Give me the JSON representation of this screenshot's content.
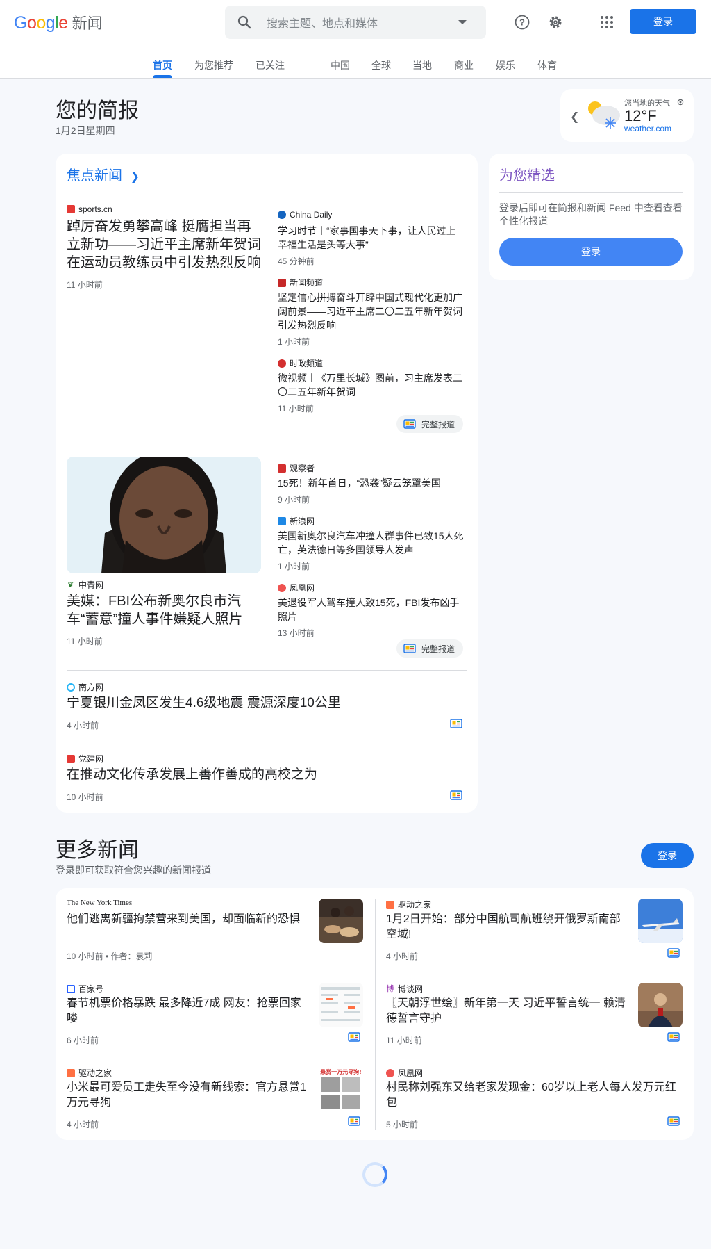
{
  "header": {
    "logo_google": "Google",
    "logo_product": "新闻",
    "search_placeholder": "搜索主题、地点和媒体",
    "signin_label": "登录",
    "icons": [
      "help-icon",
      "settings-icon",
      "apps-icon",
      "search-icon"
    ]
  },
  "tabs": [
    {
      "label": "首页",
      "active": true
    },
    {
      "label": "为您推荐"
    },
    {
      "label": "已关注"
    },
    {
      "label": "中国"
    },
    {
      "label": "全球"
    },
    {
      "label": "当地"
    },
    {
      "label": "商业"
    },
    {
      "label": "娱乐"
    },
    {
      "label": "体育"
    }
  ],
  "briefing": {
    "title": "您的简报",
    "date": "1月2日星期四"
  },
  "weather": {
    "location": "您当地的天气",
    "temp": "12°F",
    "source": "weather.com"
  },
  "top_stories": {
    "title": "焦点新闻",
    "full_coverage": "完整报道",
    "cluster1": {
      "main": {
        "source": "sports.cn",
        "headline": "踔厉奋发勇攀高峰 挺膺担当再立新功——习近平主席新年贺词在运动员教练员中引发热烈反响",
        "time": "11 小时前"
      },
      "side": [
        {
          "source": "China Daily",
          "headline": "学习时节丨“家事国事天下事，让人民过上幸福生活是头等大事”",
          "time": "45 分钟前"
        },
        {
          "source": "新闻频道",
          "headline": "坚定信心拼搏奋斗开辟中国式现代化更加广阔前景——习近平主席二〇二五年新年贺词引发热烈反响",
          "time": "1 小时前"
        },
        {
          "source": "时政频道",
          "headline": "微视频丨《万里长城》图前，习主席发表二〇二五年新年贺词",
          "time": "11 小时前"
        }
      ]
    },
    "cluster2": {
      "main": {
        "source": "中青网",
        "headline": "美媒：FBI公布新奥尔良市汽车“蓄意”撞人事件嫌疑人照片",
        "time": "11 小时前"
      },
      "side": [
        {
          "source": "观察者",
          "headline": "15死！新年首日，“恐袭”疑云笼罩美国",
          "time": "9 小时前"
        },
        {
          "source": "新浪网",
          "headline": "美国新奥尔良汽车冲撞人群事件已致15人死亡，英法德日等多国领导人发声",
          "time": "1 小时前"
        },
        {
          "source": "凤凰网",
          "headline": "美退役军人驾车撞人致15死，FBI发布凶手照片",
          "time": "13 小时前"
        }
      ]
    },
    "singles": [
      {
        "source": "南方网",
        "headline": "宁夏银川金凤区发生4.6级地震 震源深度10公里",
        "time": "4 小时前"
      },
      {
        "source": "党建网",
        "headline": "在推动文化传承发展上善作善成的高校之为",
        "time": "10 小时前"
      }
    ]
  },
  "for_you": {
    "title": "为您精选",
    "text": "登录后即可在简报和新闻 Feed 中查看查看个性化报道",
    "button": "登录"
  },
  "more_news": {
    "title": "更多新闻",
    "subtitle": "登录即可获取符合您兴趣的新闻报道",
    "button": "登录",
    "items": [
      {
        "source": "The New York Times",
        "headline": "他们逃离新疆拘禁营来到美国，却面临新的恐惧",
        "time": "10 小时前 • 作者：袁莉"
      },
      {
        "source": "驱动之家",
        "headline": "1月2日开始：部分中国航司航班绕开俄罗斯南部空域!",
        "time": "4 小时前"
      },
      {
        "source": "百家号",
        "headline": "春节机票价格暴跌 最多降近7成 网友：抢票回家喽",
        "time": "6 小时前"
      },
      {
        "source": "博谈网",
        "headline": "〖天朝浮世绘〗新年第一天 习近平誓言统一 赖清德誓言守护",
        "time": "11 小时前"
      },
      {
        "source": "驱动之家",
        "headline": "小米最可爱员工走失至今没有新线索：官方悬赏1万元寻狗",
        "time": "4 小时前"
      },
      {
        "source": "凤凰网",
        "headline": "村民称刘强东又给老家发现金：60岁以上老人每人发万元红包",
        "time": "5 小时前"
      }
    ]
  },
  "thumb_texts": {
    "dog_reward": "悬赏一万元寻狗!"
  },
  "colors": {
    "accent": "#1a73e8",
    "for_you": "#7e57c2",
    "background": "#f6f8fc"
  }
}
